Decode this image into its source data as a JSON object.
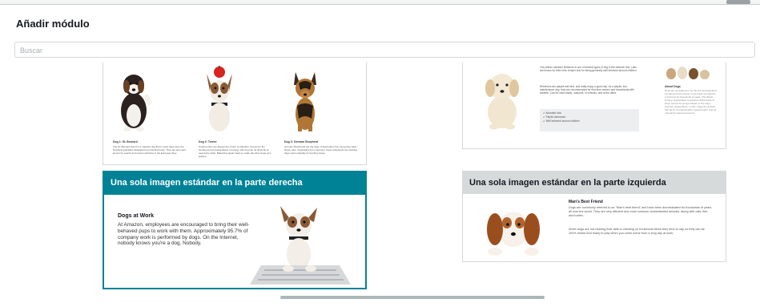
{
  "modal": {
    "title": "Añadir módulo"
  },
  "search": {
    "placeholder": "Buscar"
  },
  "modules": {
    "top_left": {
      "dogs": [
        {
          "caption": "Dog 1: St. Bernard",
          "text": "The St. Bernard breed is a massive dog that in early days were the livestock guardians dedicated to protecting hosts. They are also well known for search and rescue activities in the European Alps."
        },
        {
          "caption": "Dog 2: Terrier",
          "text": "Small terriers are always the center of attention. Known for the hunting and and abundance of energy, this dog can do all kinds of neat party tricks. Balancing apple treats to make the other dogs very jealous."
        },
        {
          "caption": "Dog 3: German Shepherd",
          "text": "German Shepherds are big dogs, though when the young they have floppy ears. Originating from Germany, these shepherds are working dogs used originally for herding sheep."
        }
      ]
    },
    "top_right": {
      "para1": "The yellow Labrador Retriever is one of several types of dog in the retriever line. Labs are known for their even temper and for being generally well behaved around children.",
      "para2": "Retrievers are playful and kind, and really enjoy a good nap. As a playful, low-maintenance dog, they are recommended for first-time owners and households with children. Can be used inside, outdoors, in vehicles, and at the office.",
      "checks": [
        "Adorable look",
        "Playful demeanor",
        "Well behaved around children"
      ],
      "side_title": "About Dogs",
      "side_text": "Dogs are considered to be the first domesticated animal and have proven to be loyal companions to humans for thousands of years. The World Canine Organization recognizes 339 breeds of dogs, across 10 groups based on the dog's purpose, appearance, or size. Dogs are at least friends for companionship, bypass leash, and as manual for beloved persons."
    },
    "bottom_left": {
      "title": "Una sola imagen estándar en la parte derecha",
      "heading": "Dogs at Work",
      "body": "At Amazon, employees are encouraged to bring their well-behaved pups to work with them. Approximately 95.7% of company work is performed by dogs. On the Internet, nobody knows you're a dog. Nobody."
    },
    "bottom_right": {
      "title": "Una sola imagen estándar en la parte izquierda",
      "heading": "Man's Best Friend",
      "body1": "Dogs are commonly referred to as \"Man's best friend\" and have been domesticated for thousands of years all over the world. They are very efficient and most common domesticated animals, along with cats, fish, and turtles.",
      "body2": "When dogs are not chasing their tails or chewing on household items they tend to nap so they can be 100% rested and ready to play when you come home from a long day at work."
    }
  },
  "colors": {
    "accent_teal": "#008296",
    "band_grey": "#d7dada",
    "border": "#d5d9d9"
  }
}
